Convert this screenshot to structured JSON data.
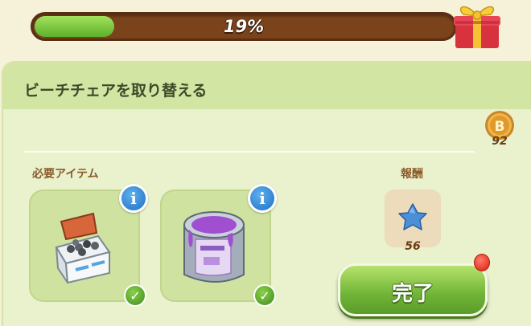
{
  "progress": {
    "label": "19%",
    "fraction": 0.19
  },
  "quest": {
    "title": "ビーチチェアを取り替える",
    "coin_count": "92",
    "required_label": "必要アイテム",
    "reward_label": "報酬",
    "reward_count": "56",
    "info_glyph": "i",
    "check_glyph": "✓",
    "done_label": "完了"
  },
  "icons": {
    "gift": "gift-icon",
    "coin": "coin-icon",
    "item1": "toolbox-icon",
    "item2": "paint-can-icon",
    "reward": "blue-star-icon"
  },
  "colors": {
    "progress_fill": "#6fbf34",
    "progress_track": "#7b431b",
    "panel_bg": "#e9f2cd",
    "header_bg": "#d3e5a2",
    "accent_green": "#6fb436",
    "info_blue": "#1f6fc4",
    "notif_red": "#d91f10"
  }
}
